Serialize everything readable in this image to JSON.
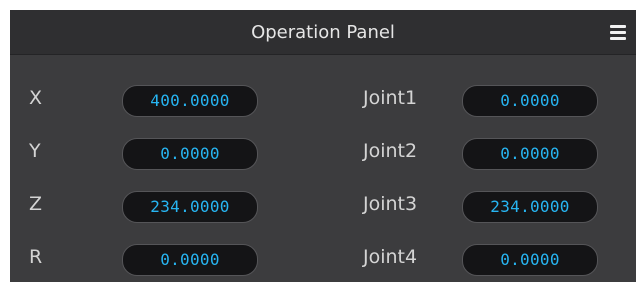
{
  "header": {
    "title": "Operation Panel",
    "menu_icon": "hamburger-menu-icon"
  },
  "cartesian": [
    {
      "label": "X",
      "value": "400.0000"
    },
    {
      "label": "Y",
      "value": "0.0000"
    },
    {
      "label": "Z",
      "value": "234.0000"
    },
    {
      "label": "R",
      "value": "0.0000"
    }
  ],
  "joints": [
    {
      "label": "Joint1",
      "value": "0.0000"
    },
    {
      "label": "Joint2",
      "value": "0.0000"
    },
    {
      "label": "Joint3",
      "value": "234.0000"
    },
    {
      "label": "Joint4",
      "value": "0.0000"
    }
  ],
  "colors": {
    "panel_bg": "#3c3c3e",
    "header_bg": "#2f2f31",
    "field_bg": "#141416",
    "value_text": "#27b5f2"
  }
}
